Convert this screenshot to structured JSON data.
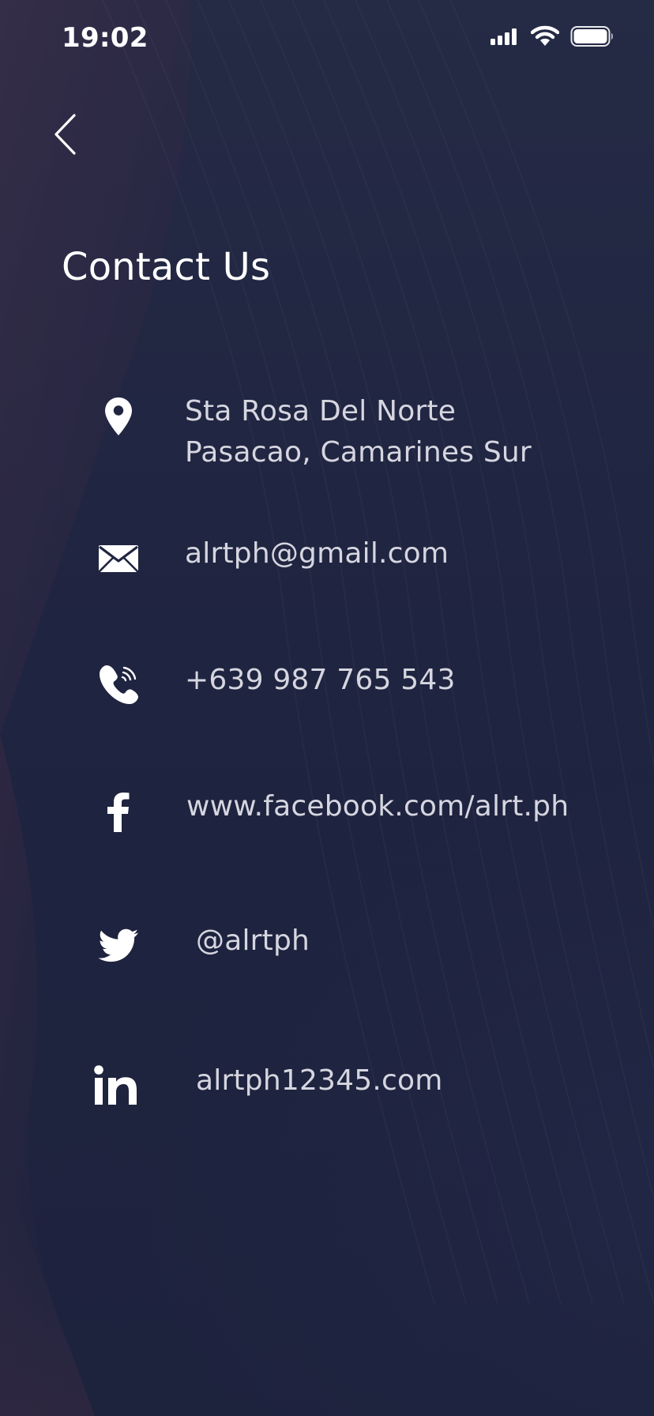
{
  "status_bar": {
    "time": "19:02"
  },
  "header": {
    "title": "Contact Us"
  },
  "contacts": {
    "address": {
      "line1": "Sta Rosa Del Norte",
      "line2": "Pasacao, Camarines Sur"
    },
    "email": "alrtph@gmail.com",
    "phone": "+639 987 765 543",
    "facebook": "www.facebook.com/alrt.ph",
    "twitter": "@alrtph",
    "linkedin": "alrtph12345.com"
  },
  "icons": {
    "back": "chevron-left-icon",
    "address": "map-pin-icon",
    "email": "envelope-icon",
    "phone": "phone-call-icon",
    "facebook": "facebook-icon",
    "twitter": "twitter-icon",
    "linkedin": "linkedin-icon"
  },
  "colors": {
    "background": "#1f2440",
    "text": "#ffffff",
    "secondary_text": "#d6d6e0"
  }
}
